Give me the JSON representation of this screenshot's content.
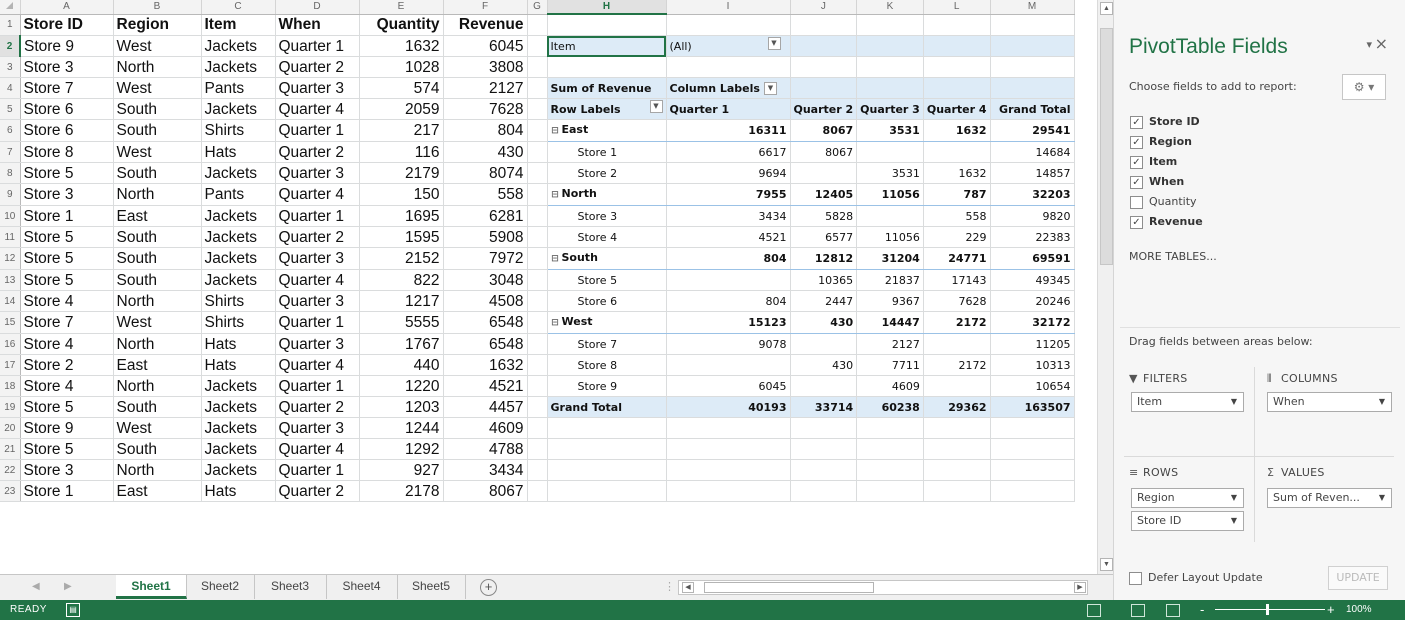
{
  "column_headers": [
    "A",
    "B",
    "C",
    "D",
    "E",
    "F",
    "G",
    "H",
    "I",
    "J",
    "K",
    "L",
    "M"
  ],
  "row_numbers": [
    "1",
    "2",
    "3",
    "4",
    "5",
    "6",
    "7",
    "8",
    "9",
    "10",
    "11",
    "12",
    "13",
    "14",
    "15",
    "16",
    "17",
    "18",
    "19",
    "20",
    "21",
    "22",
    "23"
  ],
  "data_headers": [
    "Store ID",
    "Region",
    "Item",
    "When",
    "Quantity",
    "Revenue"
  ],
  "data_rows": [
    [
      "Store 9",
      "West",
      "Jackets",
      "Quarter 1",
      "1632",
      "6045"
    ],
    [
      "Store 3",
      "North",
      "Jackets",
      "Quarter 2",
      "1028",
      "3808"
    ],
    [
      "Store 7",
      "West",
      "Pants",
      "Quarter 3",
      "574",
      "2127"
    ],
    [
      "Store 6",
      "South",
      "Jackets",
      "Quarter 4",
      "2059",
      "7628"
    ],
    [
      "Store 6",
      "South",
      "Shirts",
      "Quarter 1",
      "217",
      "804"
    ],
    [
      "Store 8",
      "West",
      "Hats",
      "Quarter 2",
      "116",
      "430"
    ],
    [
      "Store 5",
      "South",
      "Jackets",
      "Quarter 3",
      "2179",
      "8074"
    ],
    [
      "Store 3",
      "North",
      "Pants",
      "Quarter 4",
      "150",
      "558"
    ],
    [
      "Store 1",
      "East",
      "Jackets",
      "Quarter 1",
      "1695",
      "6281"
    ],
    [
      "Store 5",
      "South",
      "Jackets",
      "Quarter 2",
      "1595",
      "5908"
    ],
    [
      "Store 5",
      "South",
      "Jackets",
      "Quarter 3",
      "2152",
      "7972"
    ],
    [
      "Store 5",
      "South",
      "Jackets",
      "Quarter 4",
      "822",
      "3048"
    ],
    [
      "Store 4",
      "North",
      "Shirts",
      "Quarter 3",
      "1217",
      "4508"
    ],
    [
      "Store 7",
      "West",
      "Shirts",
      "Quarter 1",
      "5555",
      "6548"
    ],
    [
      "Store 4",
      "North",
      "Hats",
      "Quarter 3",
      "1767",
      "6548"
    ],
    [
      "Store 2",
      "East",
      "Hats",
      "Quarter 4",
      "440",
      "1632"
    ],
    [
      "Store 4",
      "North",
      "Jackets",
      "Quarter 1",
      "1220",
      "4521"
    ],
    [
      "Store 5",
      "South",
      "Jackets",
      "Quarter 2",
      "1203",
      "4457"
    ],
    [
      "Store 9",
      "West",
      "Jackets",
      "Quarter 3",
      "1244",
      "4609"
    ],
    [
      "Store 5",
      "South",
      "Jackets",
      "Quarter 4",
      "1292",
      "4788"
    ],
    [
      "Store 3",
      "North",
      "Jackets",
      "Quarter 1",
      "927",
      "3434"
    ],
    [
      "Store 1",
      "East",
      "Hats",
      "Quarter 2",
      "2178",
      "8067"
    ]
  ],
  "pivot": {
    "filter_label": "Item",
    "filter_value": "(All)",
    "value_label": "Sum of Revenue",
    "column_labels": "Column Labels",
    "row_labels": "Row Labels",
    "quarters": [
      "Quarter 1",
      "Quarter 2",
      "Quarter 3",
      "Quarter 4",
      "Grand Total"
    ],
    "rows": [
      {
        "label": "East",
        "group": true,
        "values": [
          "16311",
          "8067",
          "3531",
          "1632",
          "29541"
        ]
      },
      {
        "label": "Store 1",
        "group": false,
        "values": [
          "6617",
          "8067",
          "",
          "",
          "14684"
        ]
      },
      {
        "label": "Store 2",
        "group": false,
        "values": [
          "9694",
          "",
          "3531",
          "1632",
          "14857"
        ]
      },
      {
        "label": "North",
        "group": true,
        "values": [
          "7955",
          "12405",
          "11056",
          "787",
          "32203"
        ]
      },
      {
        "label": "Store 3",
        "group": false,
        "values": [
          "3434",
          "5828",
          "",
          "558",
          "9820"
        ]
      },
      {
        "label": "Store 4",
        "group": false,
        "values": [
          "4521",
          "6577",
          "11056",
          "229",
          "22383"
        ]
      },
      {
        "label": "South",
        "group": true,
        "values": [
          "804",
          "12812",
          "31204",
          "24771",
          "69591"
        ]
      },
      {
        "label": "Store 5",
        "group": false,
        "values": [
          "",
          "10365",
          "21837",
          "17143",
          "49345"
        ]
      },
      {
        "label": "Store 6",
        "group": false,
        "values": [
          "804",
          "2447",
          "9367",
          "7628",
          "20246"
        ]
      },
      {
        "label": "West",
        "group": true,
        "values": [
          "15123",
          "430",
          "14447",
          "2172",
          "32172"
        ]
      },
      {
        "label": "Store 7",
        "group": false,
        "values": [
          "9078",
          "",
          "2127",
          "",
          "11205"
        ]
      },
      {
        "label": "Store 8",
        "group": false,
        "values": [
          "",
          "430",
          "7711",
          "2172",
          "10313"
        ]
      },
      {
        "label": "Store 9",
        "group": false,
        "values": [
          "6045",
          "",
          "4609",
          "",
          "10654"
        ]
      }
    ],
    "grand_total": {
      "label": "Grand Total",
      "values": [
        "40193",
        "33714",
        "60238",
        "29362",
        "163507"
      ]
    }
  },
  "sheet_tabs": [
    "Sheet1",
    "Sheet2",
    "Sheet3",
    "Sheet4",
    "Sheet5"
  ],
  "status": {
    "ready": "READY",
    "zoom": "100%"
  },
  "pane": {
    "title": "PivotTable Fields",
    "choose": "Choose fields to add to report:",
    "fields": [
      {
        "name": "Store ID",
        "checked": true
      },
      {
        "name": "Region",
        "checked": true
      },
      {
        "name": "Item",
        "checked": true
      },
      {
        "name": "When",
        "checked": true
      },
      {
        "name": "Quantity",
        "checked": false
      },
      {
        "name": "Revenue",
        "checked": true
      }
    ],
    "more_tables": "MORE TABLES...",
    "drag_text": "Drag fields between areas below:",
    "filters_label": "FILTERS",
    "columns_label": "COLUMNS",
    "rows_label": "ROWS",
    "values_label": "VALUES",
    "filters_items": [
      "Item"
    ],
    "columns_items": [
      "When"
    ],
    "rows_items": [
      "Region",
      "Store ID"
    ],
    "values_items": [
      "Sum of Reven..."
    ],
    "defer_label": "Defer Layout Update",
    "update_label": "UPDATE"
  },
  "colors": {
    "excel_green": "#217346",
    "pivot_header_blue": "#ddebf7"
  }
}
